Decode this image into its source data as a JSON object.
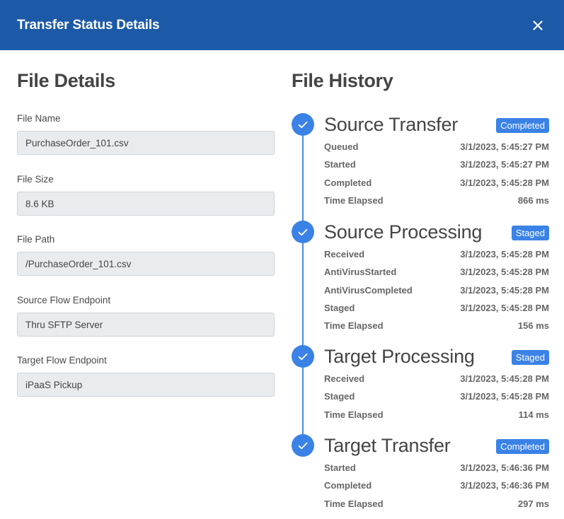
{
  "modal": {
    "title": "Transfer Status Details",
    "close_icon": "close-icon",
    "colors": {
      "header": "#1c5aa8",
      "accent": "#3b82e6",
      "input_bg": "#e9ecef"
    }
  },
  "file_details": {
    "heading": "File Details",
    "fields": [
      {
        "label": "File Name",
        "value": "PurchaseOrder_101.csv"
      },
      {
        "label": "File Size",
        "value": "8.6 KB"
      },
      {
        "label": "File Path",
        "value": "/PurchaseOrder_101.csv"
      },
      {
        "label": "Source Flow Endpoint",
        "value": "Thru SFTP Server"
      },
      {
        "label": "Target Flow Endpoint",
        "value": "iPaaS Pickup"
      }
    ]
  },
  "file_history": {
    "heading": "File History",
    "stages": [
      {
        "title": "Source Transfer",
        "badge": "Completed",
        "rows": [
          {
            "label": "Queued",
            "value": "3/1/2023, 5:45:27 PM"
          },
          {
            "label": "Started",
            "value": "3/1/2023, 5:45:27 PM"
          },
          {
            "label": "Completed",
            "value": "3/1/2023, 5:45:28 PM"
          },
          {
            "label": "Time Elapsed",
            "value": "866 ms"
          }
        ]
      },
      {
        "title": "Source Processing",
        "badge": "Staged",
        "rows": [
          {
            "label": "Received",
            "value": "3/1/2023, 5:45:28 PM"
          },
          {
            "label": "AntiVirusStarted",
            "value": "3/1/2023, 5:45:28 PM"
          },
          {
            "label": "AntiVirusCompleted",
            "value": "3/1/2023, 5:45:28 PM"
          },
          {
            "label": "Staged",
            "value": "3/1/2023, 5:45:28 PM"
          },
          {
            "label": "Time Elapsed",
            "value": "156 ms"
          }
        ]
      },
      {
        "title": "Target Processing",
        "badge": "Staged",
        "rows": [
          {
            "label": "Received",
            "value": "3/1/2023, 5:45:28 PM"
          },
          {
            "label": "Staged",
            "value": "3/1/2023, 5:45:28 PM"
          },
          {
            "label": "Time Elapsed",
            "value": "114 ms"
          }
        ]
      },
      {
        "title": "Target Transfer",
        "badge": "Completed",
        "rows": [
          {
            "label": "Started",
            "value": "3/1/2023, 5:46:36 PM"
          },
          {
            "label": "Completed",
            "value": "3/1/2023, 5:46:36 PM"
          },
          {
            "label": "Time Elapsed",
            "value": "297 ms"
          }
        ]
      }
    ]
  }
}
